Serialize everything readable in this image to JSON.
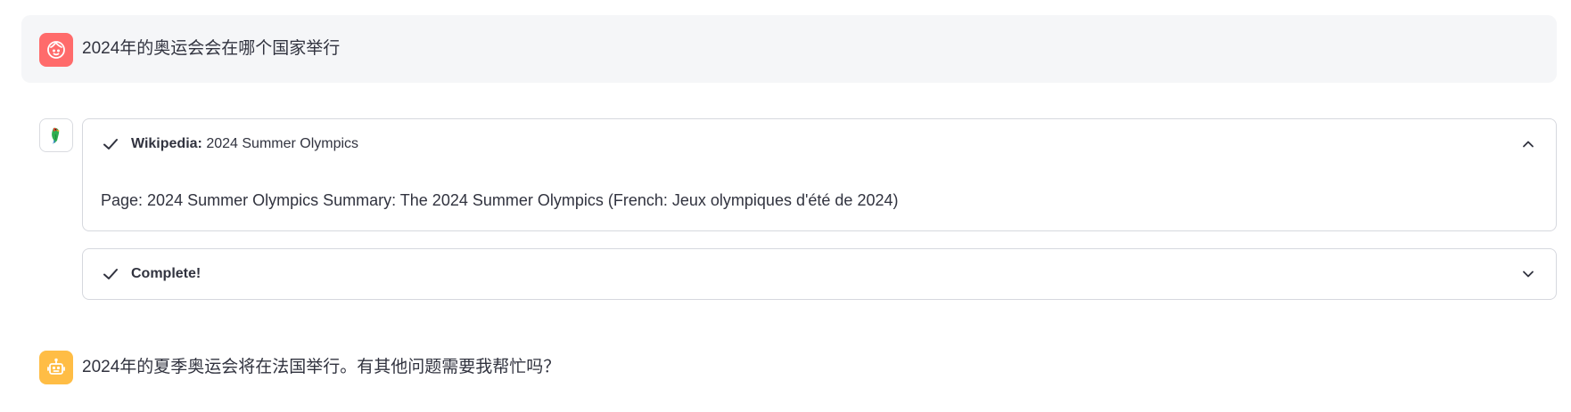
{
  "messages": {
    "user": {
      "avatar_icon": "user-face-icon",
      "avatar_color": "#ff6b6b",
      "text": "2024年的奥运会会在哪个国家举行"
    },
    "tool": {
      "avatar_icon": "parrot-icon",
      "steps": [
        {
          "status_icon": "check-icon",
          "source": "Wikipedia:",
          "title": "2024 Summer Olympics",
          "expanded": true,
          "chevron_icon": "chevron-up-icon",
          "body": "Page: 2024 Summer Olympics Summary: The 2024 Summer Olympics (French: Jeux olympiques d'été de 2024)"
        },
        {
          "status_icon": "check-icon",
          "source": "Complete!",
          "expanded": false,
          "chevron_icon": "chevron-down-icon"
        }
      ]
    },
    "assistant": {
      "avatar_icon": "robot-icon",
      "avatar_color": "#ffbd45",
      "text": "2024年的夏季奥运会将在法国举行。有其他问题需要我帮忙吗？"
    }
  }
}
